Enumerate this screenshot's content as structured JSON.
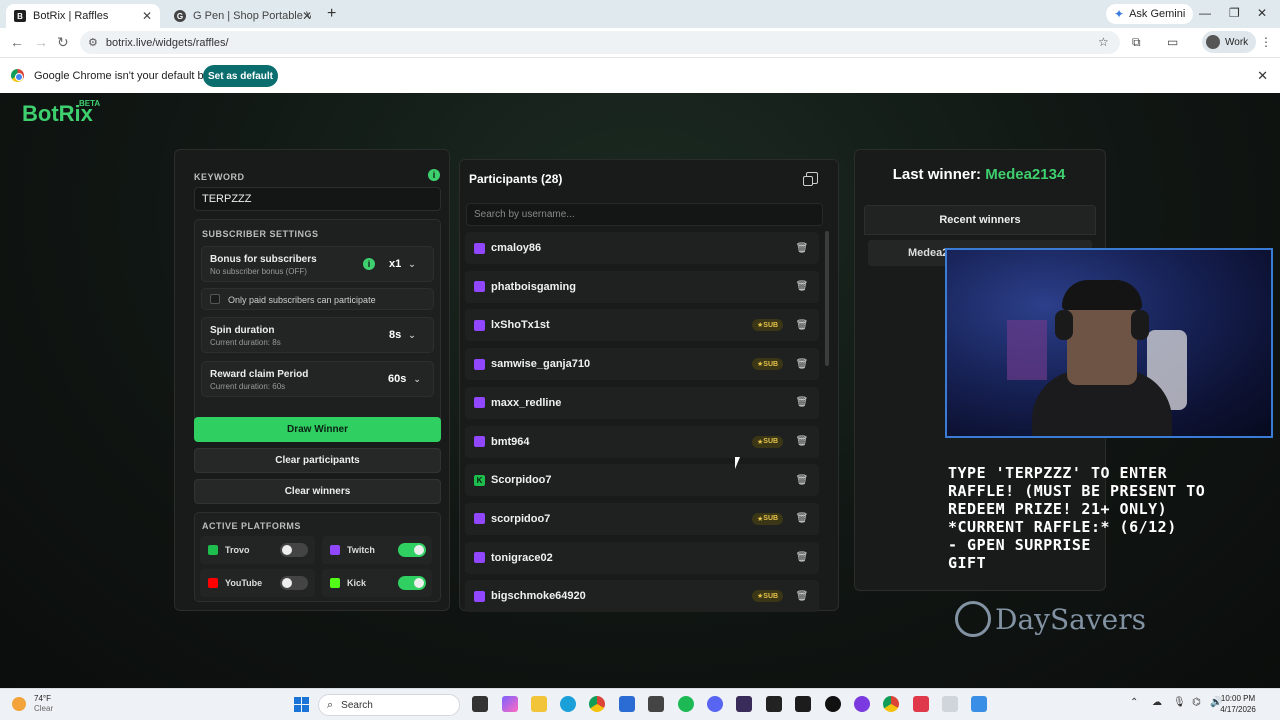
{
  "browser": {
    "tabs": [
      {
        "title": "BotRix | Raffles",
        "active": true
      },
      {
        "title": "G Pen | Shop Portable Vaporize",
        "active": false
      }
    ],
    "gemini_label": "Ask Gemini",
    "url": "botrix.live/widgets/raffles/",
    "profile_label": "Work",
    "infobar_text": "Google Chrome isn't your default browser",
    "set_default_label": "Set as default"
  },
  "app": {
    "logo": "BotRix",
    "logo_badge": "BETA"
  },
  "settings": {
    "keyword_label": "KEYWORD",
    "keyword_value": "TERPZZZ",
    "subscriber_section": "SUBSCRIBER SETTINGS",
    "bonus_title": "Bonus for subscribers",
    "bonus_sub": "No subscriber bonus (OFF)",
    "bonus_value": "x1",
    "paid_only_label": "Only paid subscribers can participate",
    "spin_title": "Spin duration",
    "spin_sub": "Current duration: 8s",
    "spin_value": "8s",
    "claim_title": "Reward claim Period",
    "claim_sub": "Current duration: 60s",
    "claim_value": "60s",
    "draw_label": "Draw Winner",
    "clear_participants_label": "Clear participants",
    "clear_winners_label": "Clear winners",
    "platforms_label": "ACTIVE PLATFORMS",
    "platforms": [
      {
        "name": "Trovo",
        "enabled": false,
        "color": "#1dbe4d"
      },
      {
        "name": "Twitch",
        "enabled": true,
        "color": "#9146ff"
      },
      {
        "name": "YouTube",
        "enabled": false,
        "color": "#ff0000"
      },
      {
        "name": "Kick",
        "enabled": true,
        "color": "#53fc18"
      }
    ]
  },
  "participants": {
    "title": "Participants (28)",
    "search_placeholder": "Search by username...",
    "sub_badge": "SUB",
    "items": [
      {
        "name": "cmaloy86",
        "platform": "twitch",
        "sub": false
      },
      {
        "name": "phatboisgaming",
        "platform": "twitch",
        "sub": false
      },
      {
        "name": "lxShoTx1st",
        "platform": "twitch",
        "sub": true
      },
      {
        "name": "samwise_ganja710",
        "platform": "twitch",
        "sub": true
      },
      {
        "name": "maxx_redline",
        "platform": "twitch",
        "sub": false
      },
      {
        "name": "bmt964",
        "platform": "twitch",
        "sub": true
      },
      {
        "name": "Scorpidoo7",
        "platform": "kick",
        "sub": false
      },
      {
        "name": "scorpidoo7",
        "platform": "twitch",
        "sub": true
      },
      {
        "name": "tonigrace02",
        "platform": "twitch",
        "sub": false
      },
      {
        "name": "bigschmoke64920",
        "platform": "twitch",
        "sub": true
      }
    ]
  },
  "winners": {
    "last_label": "Last winner:",
    "last_name": "Medea2134",
    "recent_label": "Recent winners",
    "recent_items": [
      "Medea2"
    ]
  },
  "overlay": {
    "lines": [
      "TYPE 'TERPZZZ' TO ENTER",
      "RAFFLE! (MUST BE PRESENT TO",
      "REDEEM PRIZE! 21+ ONLY)",
      "*CURRENT RAFFLE:* (6/12)",
      "- GPEN SURPRISE",
      "GIFT"
    ],
    "watermark": "DaySavers"
  },
  "taskbar": {
    "temp": "74°F",
    "condition": "Clear",
    "search_label": "Search",
    "time": "10:00 PM",
    "date": "4/17/2026"
  }
}
